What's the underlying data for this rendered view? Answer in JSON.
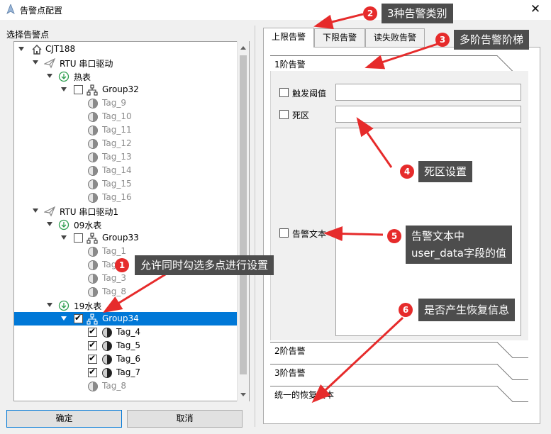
{
  "window": {
    "title": "告警点配置",
    "close_glyph": "✕"
  },
  "tree_section_label": "选择告警点",
  "tree": {
    "nodes": [
      {
        "label": "CJT188",
        "icon": "home-icon",
        "gray": false
      },
      {
        "label": "RTU 串口驱动",
        "icon": "plane-icon",
        "gray": false
      },
      {
        "label": "热表",
        "icon": "download-circle-icon",
        "gray": false
      },
      {
        "label": "Group32",
        "icon": "network-icon",
        "gray": false
      },
      {
        "label": "Tag_9",
        "icon": "half-circle-icon",
        "gray": true
      },
      {
        "label": "Tag_10",
        "icon": "half-circle-icon",
        "gray": true
      },
      {
        "label": "Tag_11",
        "icon": "half-circle-icon",
        "gray": true
      },
      {
        "label": "Tag_12",
        "icon": "half-circle-icon",
        "gray": true
      },
      {
        "label": "Tag_13",
        "icon": "half-circle-icon",
        "gray": true
      },
      {
        "label": "Tag_14",
        "icon": "half-circle-icon",
        "gray": true
      },
      {
        "label": "Tag_15",
        "icon": "half-circle-icon",
        "gray": true
      },
      {
        "label": "Tag_16",
        "icon": "half-circle-icon",
        "gray": true
      },
      {
        "label": "RTU 串口驱动1",
        "icon": "plane-icon",
        "gray": false
      },
      {
        "label": "09水表",
        "icon": "download-circle-icon",
        "gray": false
      },
      {
        "label": "Group33",
        "icon": "network-icon",
        "gray": false
      },
      {
        "label": "Tag_1",
        "icon": "half-circle-icon",
        "gray": true
      },
      {
        "label": "Tag_2",
        "icon": "half-circle-icon",
        "gray": true
      },
      {
        "label": "Tag_3",
        "icon": "half-circle-icon",
        "gray": true
      },
      {
        "label": "Tag_8",
        "icon": "half-circle-icon",
        "gray": true
      },
      {
        "label": "19水表",
        "icon": "download-circle-icon",
        "gray": false
      },
      {
        "label": "Group34",
        "icon": "network-icon",
        "gray": false,
        "checked": true,
        "selected": true
      },
      {
        "label": "Tag_4",
        "icon": "half-circle-icon",
        "gray": false,
        "checked": true
      },
      {
        "label": "Tag_5",
        "icon": "half-circle-icon",
        "gray": false,
        "checked": true
      },
      {
        "label": "Tag_6",
        "icon": "half-circle-icon",
        "gray": false,
        "checked": true
      },
      {
        "label": "Tag_7",
        "icon": "half-circle-icon",
        "gray": false,
        "checked": true
      },
      {
        "label": "Tag_8",
        "icon": "half-circle-icon",
        "gray": true
      }
    ]
  },
  "buttons": {
    "ok": "确定",
    "cancel": "取消"
  },
  "tabs": [
    "上限告警",
    "下限告警",
    "读失败告警"
  ],
  "active_tab": 0,
  "stages": [
    "1阶告警",
    "2阶告警",
    "3阶告警",
    "统一的恢复文本"
  ],
  "form": {
    "trigger_threshold_label": "触发阈值",
    "trigger_threshold_value": "",
    "deadband_label": "死区",
    "deadband_value": "",
    "alarm_text_label": "告警文本",
    "alarm_text_value": ""
  },
  "annotations": [
    {
      "num": "1",
      "text": "允许同时勾选多点进行设置"
    },
    {
      "num": "2",
      "text": "3种告警类别"
    },
    {
      "num": "3",
      "text": "多阶告警阶梯"
    },
    {
      "num": "4",
      "text": "死区设置"
    },
    {
      "num": "5",
      "text": "告警文本中",
      "text2": "user_data字段的值"
    },
    {
      "num": "6",
      "text": "是否产生恢复信息"
    }
  ],
  "colors": {
    "selection": "#0078d7",
    "annotation_bg": "#4d4d4d",
    "badge": "#e62b2b",
    "arrow": "#e62b2b"
  }
}
